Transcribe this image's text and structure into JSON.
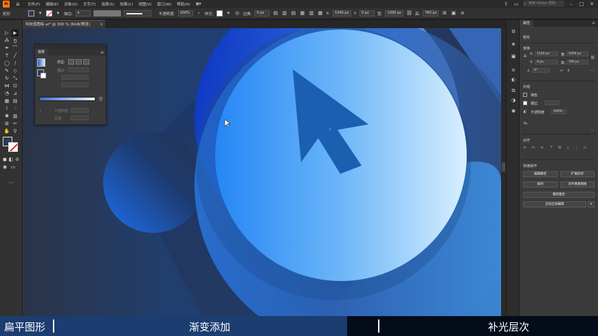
{
  "menubar": {
    "logo": "Ai",
    "items": [
      "文件(F)",
      "编辑(E)",
      "对象(O)",
      "文字(T)",
      "选择(S)",
      "效果(C)",
      "视图(V)",
      "窗口(W)",
      "帮助(H)"
    ],
    "search_placeholder": "搜索 Adobe 帮助"
  },
  "controlbar": {
    "object_label": "矩形",
    "stroke_label": "描边:",
    "stroke_style": "基本",
    "opacity_label": "不透明度:",
    "opacity_value": "100%",
    "style_label": "样式:",
    "corner_label": "边角:",
    "corner_value": "0 px",
    "w_label": "宽:",
    "w_value": "1540 px",
    "x_label": "X:",
    "x_value": "0 px",
    "h_label": "高:",
    "h_value": "1000 px",
    "y_label": "Y:",
    "y_value": "760 px"
  },
  "document": {
    "tab_title": "科技感图标.ai* @ 300 % (RGB/预览)",
    "close": "×"
  },
  "gradient_panel": {
    "title": "渐变",
    "type_label": "类型:",
    "stroke_label": "描边:",
    "opacity_label": "不透明度:",
    "location_label": "位置:"
  },
  "properties": {
    "tab": "属性",
    "selection": "矩形",
    "transform_title": "变换",
    "x_label": "X:",
    "x_value": "1540 px",
    "y_label": "Y:",
    "y_value": "0 px",
    "w_label": "宽:",
    "w_value": "1000 px",
    "h_label": "高:",
    "h_value": "760 px",
    "angle_value": "0°",
    "appearance_title": "外观",
    "fill_label": "填色",
    "stroke_label": "描边",
    "opacity_label": "不透明度",
    "opacity_value": "100%",
    "fx_label": "fx.",
    "align_title": "对齐",
    "quick_actions_title": "快速操作",
    "btn_edit_group": "编辑路径",
    "btn_expand": "扩展形状",
    "btn_arrange": "排列",
    "btn_pixel": "对齐像素网格",
    "btn_recolor": "重新着色",
    "btn_global_edit": "启动全局编辑"
  },
  "subtitles": {
    "left": "扁平图形",
    "middle": "渐变添加",
    "right": "补光层次"
  },
  "colors": {
    "canvas_bg": "#2b3446",
    "subtitle_blue": "#1c3d70",
    "subtitle_dark": "#040c1a",
    "cursor_blue": "#1a5fb0"
  }
}
